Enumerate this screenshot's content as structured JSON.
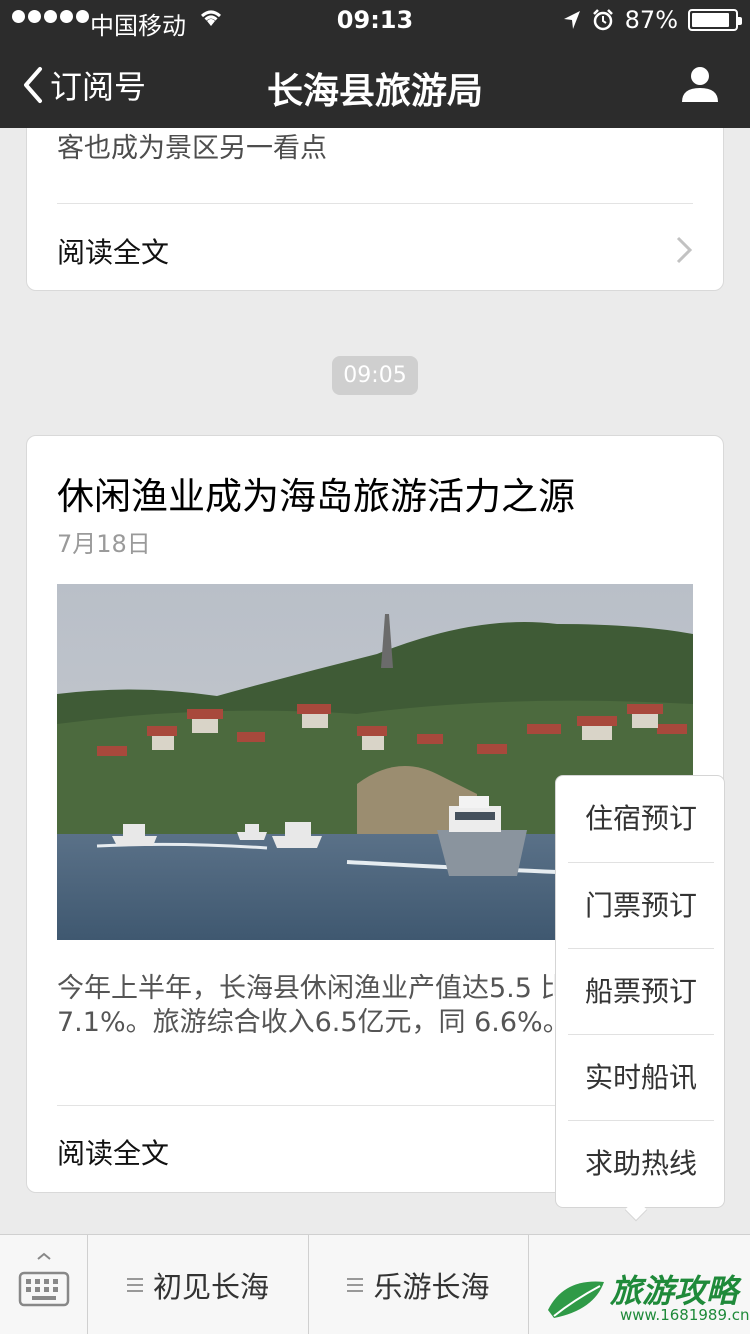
{
  "status_bar": {
    "carrier": "中国移动",
    "time": "09:13",
    "battery_percent": "87%",
    "battery_level": 0.87,
    "icons": [
      "signal-dots",
      "wifi-icon",
      "location-arrow-icon",
      "alarm-icon",
      "battery-icon"
    ]
  },
  "nav": {
    "back_label": "订阅号",
    "title": "长海县旅游局",
    "profile_icon": "person-icon"
  },
  "article_prev": {
    "excerpt": "客也成为景区另一看点",
    "read_more": "阅读全文"
  },
  "timestamp": "09:05",
  "article": {
    "title": "休闲渔业成为海岛旅游活力之源",
    "date": "7月18日",
    "image_subject": "boats-near-island-photo",
    "summary": "今年上半年，长海县休闲渔业产值达5.5 比增长7.1%。旅游综合收入6.5亿元，同 6.6%。以赶",
    "read_more": "阅读全文"
  },
  "popup_menu": {
    "items": [
      "住宿预订",
      "门票预订",
      "船票预订",
      "实时船讯",
      "求助热线"
    ]
  },
  "bottom_menu": {
    "keyboard_icon": "keyboard-icon",
    "tabs": [
      {
        "label": "初见长海"
      },
      {
        "label": "乐游长海"
      }
    ]
  },
  "watermark": {
    "text": "旅游攻略",
    "url": "www.1681989.cn"
  },
  "colors": {
    "nav_bg": "#2c2c2c",
    "page_bg": "#ebebeb",
    "watermark_green": "#1f8a3a"
  }
}
